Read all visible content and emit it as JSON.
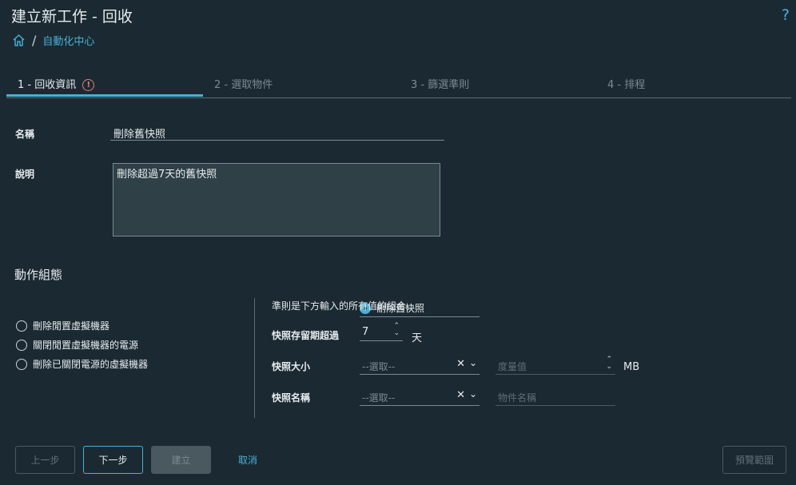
{
  "header": {
    "title": "建立新工作 - 回收",
    "help_label": "?"
  },
  "breadcrumb": {
    "home_icon": "home-icon",
    "separator": "/",
    "link": "自動化中心"
  },
  "tabs": [
    {
      "label": "1 - 回收資訊",
      "error_glyph": "!"
    },
    {
      "label": "2 - 選取物件"
    },
    {
      "label": "3 - 篩選準則"
    },
    {
      "label": "4 - 排程"
    }
  ],
  "form": {
    "name_label": "名稱",
    "name_value": "刪除舊快照",
    "desc_label": "說明",
    "desc_value": "刪除超過7天的舊快照"
  },
  "action_config": {
    "title": "動作組態",
    "options": [
      {
        "label": "刪除舊快照",
        "selected": true
      },
      {
        "label": "刪除閒置虛擬機器",
        "selected": false
      },
      {
        "label": "關閉閒置虛擬機器的電源",
        "selected": false
      },
      {
        "label": "刪除已關閉電源的虛擬機器",
        "selected": false
      }
    ]
  },
  "criteria": {
    "note": "準則是下方輸入的所有值的組合。",
    "age_label": "快照存留期超過",
    "age_value": "7",
    "age_unit": "天",
    "size_label": "快照大小",
    "size_select_placeholder": "--選取--",
    "size_value_placeholder": "度量值",
    "size_unit": "MB",
    "name_label": "快照名稱",
    "name_select_placeholder": "--選取--",
    "name_value_placeholder": "物件名稱",
    "clear_glyph": "✕",
    "chevron_glyph": "⌄"
  },
  "footer": {
    "prev": "上一步",
    "next": "下一步",
    "create": "建立",
    "cancel": "取消",
    "preview": "預覽範圍"
  },
  "colors": {
    "background": "#1b2a32",
    "accent": "#49afd9",
    "error": "#e57e70"
  }
}
